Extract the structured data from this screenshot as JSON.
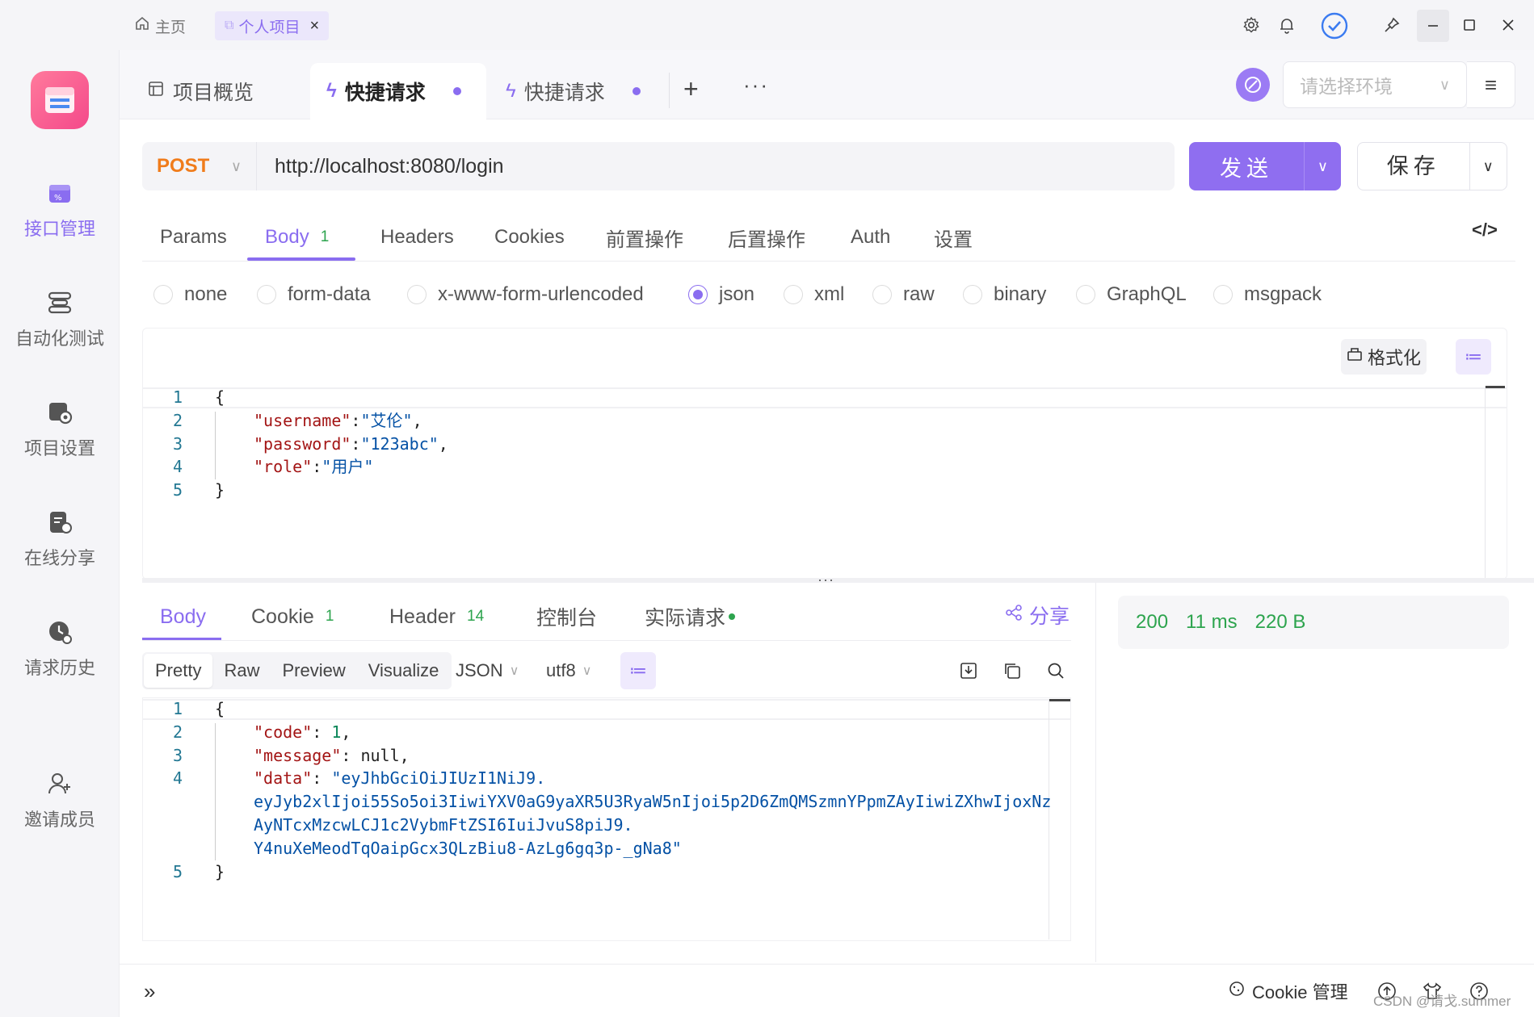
{
  "titlebar": {
    "home_tab": "主页",
    "project_tab": "个人项目",
    "close_glyph": "×"
  },
  "sidebar": {
    "items": [
      {
        "label": "接口管理",
        "icon": "api-icon"
      },
      {
        "label": "自动化测试",
        "icon": "automation-icon"
      },
      {
        "label": "项目设置",
        "icon": "project-settings-icon"
      },
      {
        "label": "在线分享",
        "icon": "share-doc-icon"
      },
      {
        "label": "请求历史",
        "icon": "history-icon"
      },
      {
        "label": "邀请成员",
        "icon": "invite-member-icon"
      }
    ]
  },
  "doc_tabs": [
    {
      "label": "项目概览"
    },
    {
      "label": "快捷请求"
    },
    {
      "label": "快捷请求"
    }
  ],
  "environment": {
    "placeholder": "请选择环境"
  },
  "request": {
    "method": "POST",
    "url": "http://localhost:8080/login",
    "send_label": "发送",
    "save_label": "保存"
  },
  "request_tabs": [
    {
      "label": "Params"
    },
    {
      "label": "Body",
      "count": "1"
    },
    {
      "label": "Headers"
    },
    {
      "label": "Cookies"
    },
    {
      "label": "前置操作"
    },
    {
      "label": "后置操作"
    },
    {
      "label": "Auth"
    },
    {
      "label": "设置"
    }
  ],
  "body_types": [
    "none",
    "form-data",
    "x-www-form-urlencoded",
    "json",
    "xml",
    "raw",
    "binary",
    "GraphQL",
    "msgpack"
  ],
  "body_type_selected": "json",
  "format_label": "格式化",
  "request_body": {
    "lines": [
      "1",
      "2",
      "3",
      "4",
      "5"
    ],
    "open": "{",
    "close": "}",
    "username_key": "\"username\"",
    "username_val": "\"艾伦\"",
    "password_key": "\"password\"",
    "password_val": "\"123abc\"",
    "role_key": "\"role\"",
    "role_val": "\"用户\""
  },
  "response_tabs": [
    {
      "label": "Body"
    },
    {
      "label": "Cookie",
      "count": "1"
    },
    {
      "label": "Header",
      "count": "14"
    },
    {
      "label": "控制台"
    },
    {
      "label": "实际请求"
    }
  ],
  "share_label": "分享",
  "status": {
    "code": "200",
    "time": "11 ms",
    "size": "220 B"
  },
  "view_modes": [
    "Pretty",
    "Raw",
    "Preview",
    "Visualize"
  ],
  "format_select": "JSON",
  "encoding_select": "utf8",
  "response_body": {
    "lines": [
      "1",
      "2",
      "3",
      "4",
      "5"
    ],
    "open": "{",
    "close": "}",
    "code_key": "\"code\"",
    "code_val": "1",
    "message_key": "\"message\"",
    "message_val": "null",
    "data_key": "\"data\"",
    "data_val_1": "\"eyJhbGciOiJIUzI1NiJ9.",
    "data_val_2": "eyJyb2xlIjoi55So5oi3IiwiYXV0aG9yaXR5U3RyaW5nIjoi5p2D6ZmQMSzmnYPpmZAyIiwiZXhwIjoxNz",
    "data_val_3": "AyNTcxMzcwLCJ1c2VybmFtZSI6IuiJvuS8piJ9.",
    "data_val_4": "Y4nuXeMeodTqOaipGcx3QLzBiu8-AzLg6gq3p-_gNa8\""
  },
  "footer": {
    "cookie_manage": "Cookie 管理",
    "watermark": "CSDN @请戈.summer"
  },
  "colors": {
    "accent": "#8a6df0",
    "method": "#f07c1b",
    "status_ok": "#2da44e"
  }
}
